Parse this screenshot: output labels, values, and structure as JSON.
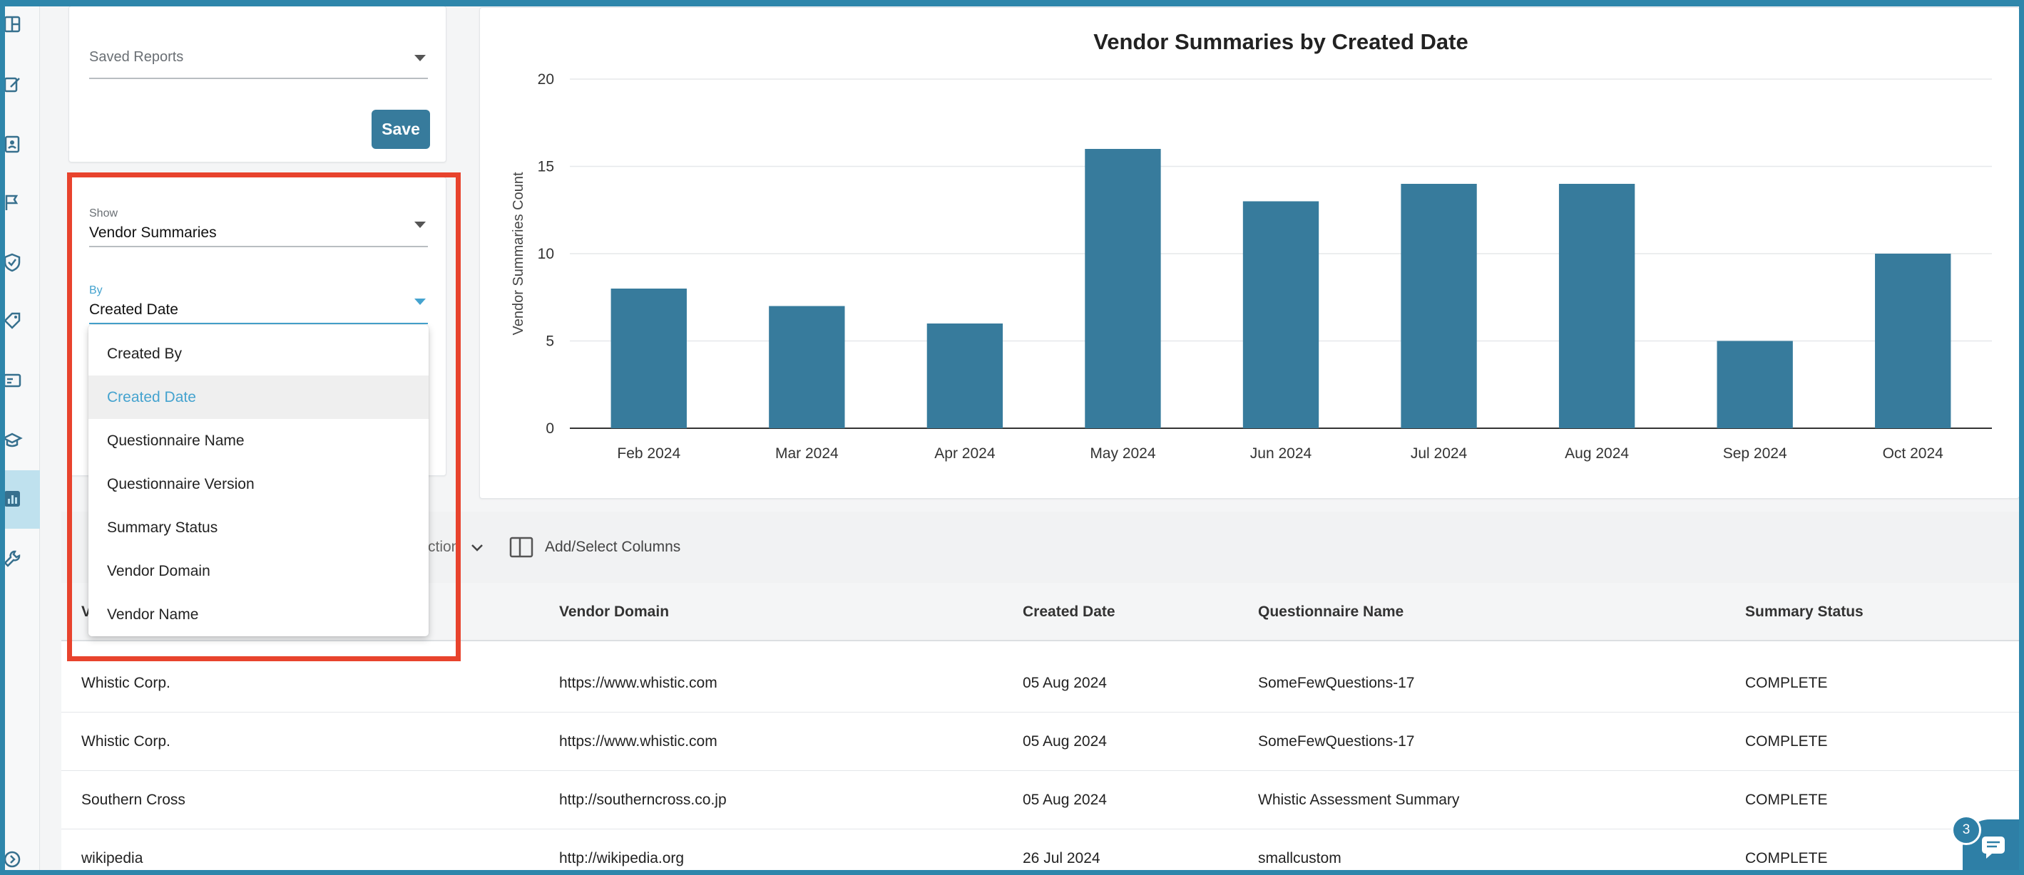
{
  "saved_reports": {
    "placeholder": "Saved Reports",
    "save_label": "Save"
  },
  "filters": {
    "show_label": "Show",
    "show_value": "Vendor Summaries",
    "by_label": "By",
    "by_value": "Created Date"
  },
  "by_menu": {
    "items": [
      "Created By",
      "Created Date",
      "Questionnaire Name",
      "Questionnaire Version",
      "Summary Status",
      "Vendor Domain",
      "Vendor Name"
    ],
    "selected": "Created Date"
  },
  "chart_data": {
    "type": "bar",
    "title": "Vendor Summaries by Created Date",
    "ylabel": "Vendor Summaries Count",
    "xlabel": "",
    "categories": [
      "Feb 2024",
      "Mar 2024",
      "Apr 2024",
      "May 2024",
      "Jun 2024",
      "Jul 2024",
      "Aug 2024",
      "Sep 2024",
      "Oct 2024"
    ],
    "values": [
      8,
      7,
      6,
      16,
      13,
      14,
      14,
      5,
      10
    ],
    "ylim": [
      0,
      20
    ],
    "yticks": [
      0,
      5,
      10,
      15,
      20
    ],
    "grid": true,
    "bar_color": "#377b9c"
  },
  "toolbar": {
    "partial_label": "ction",
    "columns_label": "Add/Select Columns"
  },
  "table": {
    "headers": [
      "Vendor Name",
      "Vendor Domain",
      "Created Date",
      "Questionnaire Name",
      "Summary Status"
    ],
    "first_header_visible": "V",
    "rows": [
      [
        "Whistic Corp.",
        "https://www.whistic.com",
        "05 Aug 2024",
        "SomeFewQuestions-17",
        "COMPLETE"
      ],
      [
        "Whistic Corp.",
        "https://www.whistic.com",
        "05 Aug 2024",
        "SomeFewQuestions-17",
        "COMPLETE"
      ],
      [
        "Southern Cross",
        "http://southerncross.co.jp",
        "05 Aug 2024",
        "Whistic Assessment Summary",
        "COMPLETE"
      ],
      [
        "wikipedia",
        "http://wikipedia.org",
        "26 Jul 2024",
        "smallcustom",
        "COMPLETE"
      ]
    ]
  },
  "chat": {
    "badge_count": "3"
  },
  "colors": {
    "accent": "#45a3cf",
    "brand": "#377b9c",
    "highlight": "#e8432d"
  }
}
